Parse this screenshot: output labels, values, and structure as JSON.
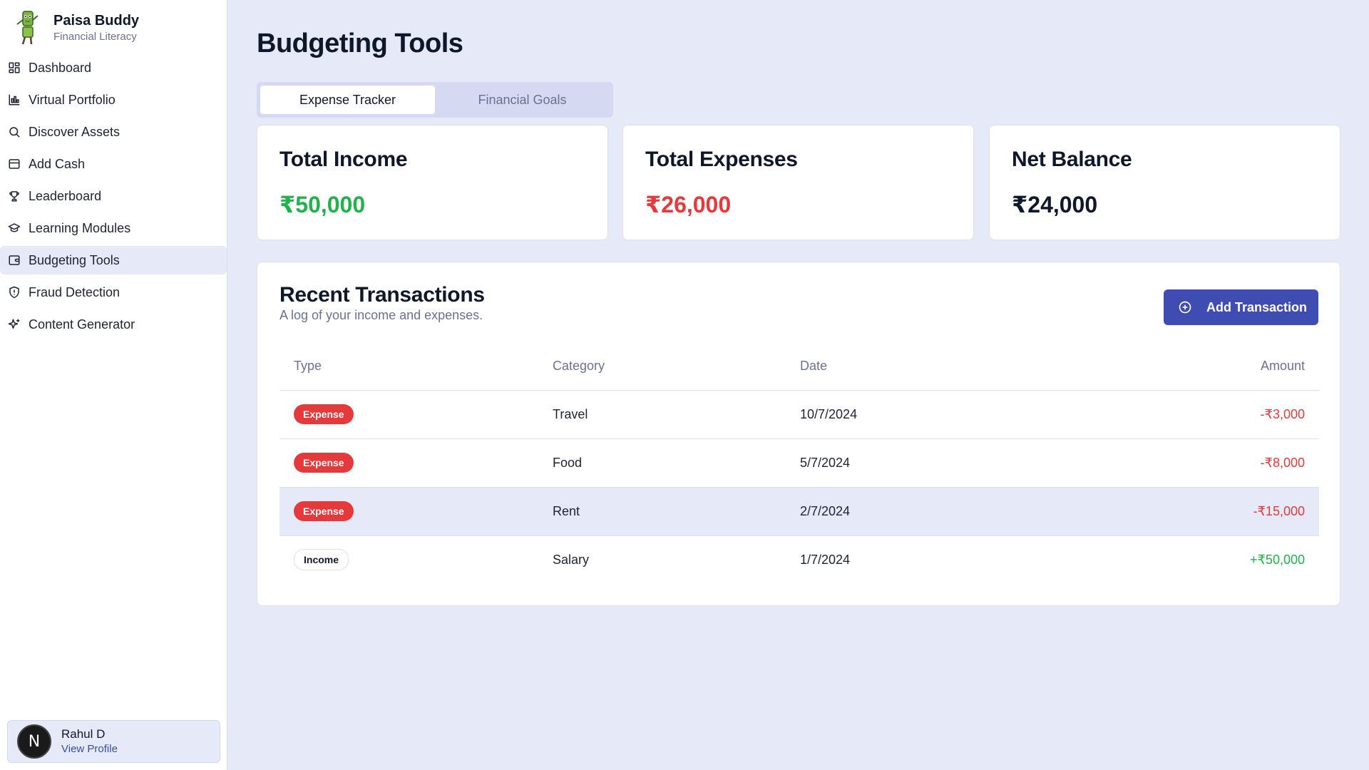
{
  "brand": {
    "name": "Paisa Buddy",
    "subtitle": "Financial Literacy"
  },
  "nav": [
    {
      "label": "Dashboard",
      "icon": "grid-icon"
    },
    {
      "label": "Virtual Portfolio",
      "icon": "chart-icon"
    },
    {
      "label": "Discover Assets",
      "icon": "search-icon"
    },
    {
      "label": "Add Cash",
      "icon": "wallet-icon"
    },
    {
      "label": "Leaderboard",
      "icon": "trophy-icon"
    },
    {
      "label": "Learning Modules",
      "icon": "graduation-cap-icon"
    },
    {
      "label": "Budgeting Tools",
      "icon": "wallet-card-icon",
      "active": true
    },
    {
      "label": "Fraud Detection",
      "icon": "shield-icon"
    },
    {
      "label": "Content Generator",
      "icon": "sparkles-icon"
    }
  ],
  "profile": {
    "name": "Rahul D",
    "link": "View Profile",
    "initial": "N"
  },
  "page": {
    "title": "Budgeting Tools"
  },
  "tabs": [
    {
      "label": "Expense Tracker",
      "active": true
    },
    {
      "label": "Financial Goals"
    }
  ],
  "stats": {
    "income": {
      "label": "Total Income",
      "value": "₹50,000",
      "color": "#22b14c"
    },
    "expenses": {
      "label": "Total Expenses",
      "value": "₹26,000",
      "color": "#e5393b"
    },
    "balance": {
      "label": "Net Balance",
      "value": "₹24,000",
      "color": "#0f172a"
    }
  },
  "transactions": {
    "title": "Recent Transactions",
    "subtitle": "A log of your income and expenses.",
    "add_label": "Add Transaction",
    "columns": {
      "type": "Type",
      "category": "Category",
      "date": "Date",
      "amount": "Amount"
    },
    "rows": [
      {
        "type": "Expense",
        "category": "Travel",
        "date": "10/7/2024",
        "amount": "-₹3,000"
      },
      {
        "type": "Expense",
        "category": "Food",
        "date": "5/7/2024",
        "amount": "-₹8,000"
      },
      {
        "type": "Expense",
        "category": "Rent",
        "date": "2/7/2024",
        "amount": "-₹15,000"
      },
      {
        "type": "Income",
        "category": "Salary",
        "date": "1/7/2024",
        "amount": "+₹50,000"
      }
    ]
  },
  "colors": {
    "accent": "#3f4cb2",
    "expense": "#e5393b",
    "income": "#22b14c"
  }
}
